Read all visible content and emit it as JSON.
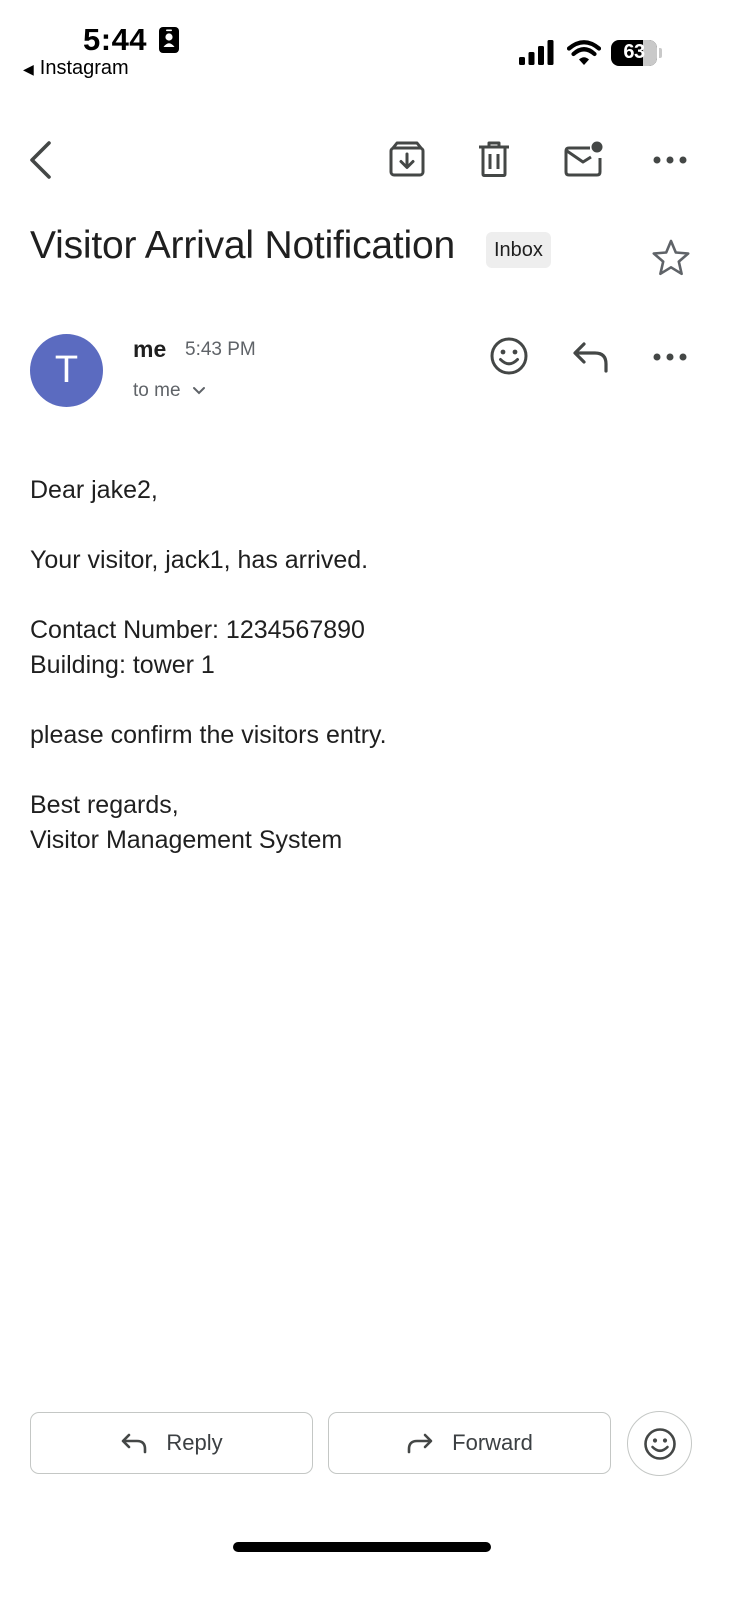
{
  "status_bar": {
    "time": "5:44",
    "back_app": "Instagram",
    "battery": "63",
    "icons": [
      "contact-badge-icon",
      "cellular-signal-icon",
      "wifi-icon",
      "battery-icon"
    ]
  },
  "toolbar": {
    "icons": [
      "back-arrow-icon",
      "archive-icon",
      "delete-icon",
      "mark-unread-icon",
      "more-icon"
    ]
  },
  "email": {
    "subject": "Visitor Arrival Notification",
    "label": "Inbox",
    "starred": false,
    "sender": {
      "avatar_initial": "T",
      "avatar_color": "#5b6bc0",
      "name": "me",
      "time": "5:43 PM",
      "recipients": "to me"
    },
    "body": {
      "greeting": "Dear jake2,",
      "arrival": "Your visitor, jack1, has arrived.",
      "contact": "Contact Number: 1234567890",
      "building": "Building: tower 1",
      "request": "please confirm the visitors entry.",
      "signoff": "Best regards,",
      "signature": "Visitor Management System"
    }
  },
  "actions": {
    "reply_label": "Reply",
    "forward_label": "Forward"
  },
  "colors": {
    "text": "#1f1f1f",
    "secondary": "#5f6368",
    "avatar": "#5b6bc0",
    "chip_bg": "#eeeeee",
    "border": "#c4c7c5"
  }
}
